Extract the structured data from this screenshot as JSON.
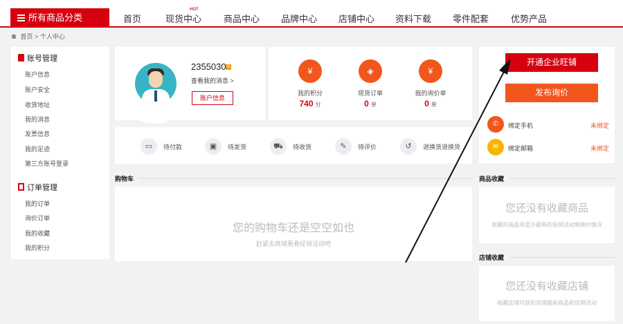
{
  "header": {
    "all_categories": "所有商品分类",
    "nav": [
      "首页",
      "现货中心",
      "商品中心",
      "品牌中心",
      "店铺中心",
      "资料下载",
      "零件配套",
      "优势产品"
    ],
    "hot_badge": "HOT"
  },
  "breadcrumb": {
    "home": "首页",
    "separator": ">",
    "current": "个人中心"
  },
  "sidebar": {
    "account_title": "账号管理",
    "account_items": [
      "账户信息",
      "账户安全",
      "收货地址",
      "我的消息",
      "发票信息",
      "我的足迹",
      "第三方账号登录"
    ],
    "order_title": "订单管理",
    "order_items": [
      "我的订单",
      "询价订单",
      "我的收藏",
      "我的积分"
    ]
  },
  "profile": {
    "username": "2355030",
    "vip_badge": "V",
    "message_link": "查看我的消息 >",
    "account_button": "账户信息"
  },
  "stats": [
    {
      "label": "我的积分",
      "value": "740",
      "unit": "分",
      "icon": "points-icon",
      "glyph": "¥"
    },
    {
      "label": "现货订单",
      "value": "0",
      "unit": "单",
      "icon": "stock-order-icon",
      "glyph": "◈"
    },
    {
      "label": "我的询价单",
      "value": "0",
      "unit": "单",
      "icon": "inquiry-icon",
      "glyph": "¥"
    }
  ],
  "order_status": [
    {
      "label": "待付款",
      "icon": "wallet-icon",
      "glyph": "▭"
    },
    {
      "label": "待发货",
      "icon": "package-icon",
      "glyph": "▣"
    },
    {
      "label": "待收货",
      "icon": "truck-icon",
      "glyph": "⛟"
    },
    {
      "label": "待评价",
      "icon": "edit-icon",
      "glyph": "✎"
    },
    {
      "label": "退换货退换货",
      "icon": "return-icon",
      "glyph": "↺"
    }
  ],
  "cart": {
    "title": "购物车",
    "empty_text": "您的购物车还是空空如也",
    "hint": "赶紧去商城看看促销活动吧"
  },
  "right": {
    "open_shop_button": "开通企业旺铺",
    "post_inquiry_button": "发布询价",
    "bind_phone": "绑定手机",
    "bind_email": "绑定邮箱",
    "unbound": "未绑定"
  },
  "favorites_products": {
    "title": "商品收藏",
    "empty_text": "您还没有收藏商品",
    "hint": "收藏的商品将显示最新的促销活动和降价情况"
  },
  "favorites_shops": {
    "title": "店铺收藏",
    "empty_text": "您还没有收藏店铺",
    "hint": "收藏店铺可获知店铺最新商品和促销活动"
  },
  "colors": {
    "brand_red": "#d6000f",
    "accent_orange": "#f2561d"
  }
}
